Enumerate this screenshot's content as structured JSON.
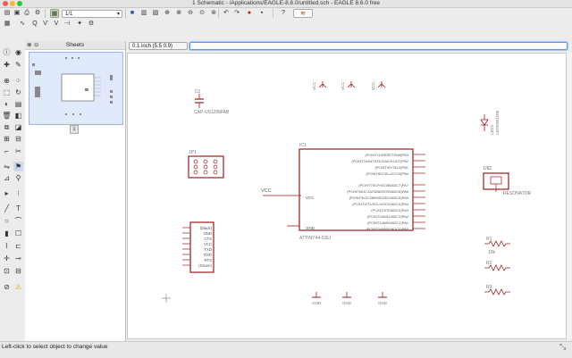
{
  "window": {
    "title": "1 Schematic - /Applications/EAGLE-8.6.0/untitled.sch - EAGLE 8.6.0 free"
  },
  "toolbar": {
    "sheet_select": "1/1",
    "coord_display": "0.1 inch (5.5 0.9)",
    "command_input": ""
  },
  "sheets_panel": {
    "title": "Sheets",
    "sheet_number": "1"
  },
  "schematic": {
    "capacitor": {
      "name": "C1",
      "value": "CAP-US1206FAB"
    },
    "jp1": {
      "name": "JP1"
    },
    "ftdi": {
      "pins": [
        "(Black)",
        "GND",
        "CTS",
        "VCC",
        "TXD",
        "RXD",
        "RTS",
        "(Green)"
      ]
    },
    "ic": {
      "name": "IC1",
      "value": "ATTINY44-SSU",
      "vcc_pin": "VCC",
      "gnd_pin": "GND",
      "left_label": "VCC",
      "pins_top": [
        "(PCINT11/RESET/DW)PB3",
        "(PCINT10/INT0/OC0A/CKOUT)PB2",
        "(PCINT9/XTAL2)PB1",
        "(PCINT8/XTAL1/CLKI)PB0"
      ],
      "pins_bottom": [
        "(PCINT7/ICP/OC0B/ADC7)PA7",
        "(PCINT6/OC1A/SDA/MOSI/ADC6)PA6",
        "(PCINT5/OC1B/MISO/DO/ADC5)PA5",
        "(PCINT4/T1/SCL/USCK/ADC4)PA4",
        "(PCINT3/T0/ADC3)PA3",
        "(PCINT2/AIN1/ADC2)PA2",
        "(PCINT1/AIN0/ADC1)PA1",
        "(PCINT0/AREF/ADC0)PA0"
      ]
    },
    "vcc_symbols": [
      "VCC",
      "VCC",
      "VCC"
    ],
    "gnd_symbols": [
      "GND",
      "GND",
      "GND"
    ],
    "led": {
      "name": "LED1",
      "value": "LEDFAB1206"
    },
    "resonator": {
      "name": "U$2",
      "value": "RESONATOR"
    },
    "resistors": [
      {
        "name": "R1",
        "value": "10k"
      },
      {
        "name": "R2",
        "value": ""
      },
      {
        "name": "R3",
        "value": ""
      }
    ]
  },
  "status": {
    "text": "Left-click to select object to change value"
  },
  "colors": {
    "accent": "#1e6cf2",
    "part": "#9e1b1b",
    "label": "#6d6d6d",
    "selection": "#dfe9fb"
  }
}
